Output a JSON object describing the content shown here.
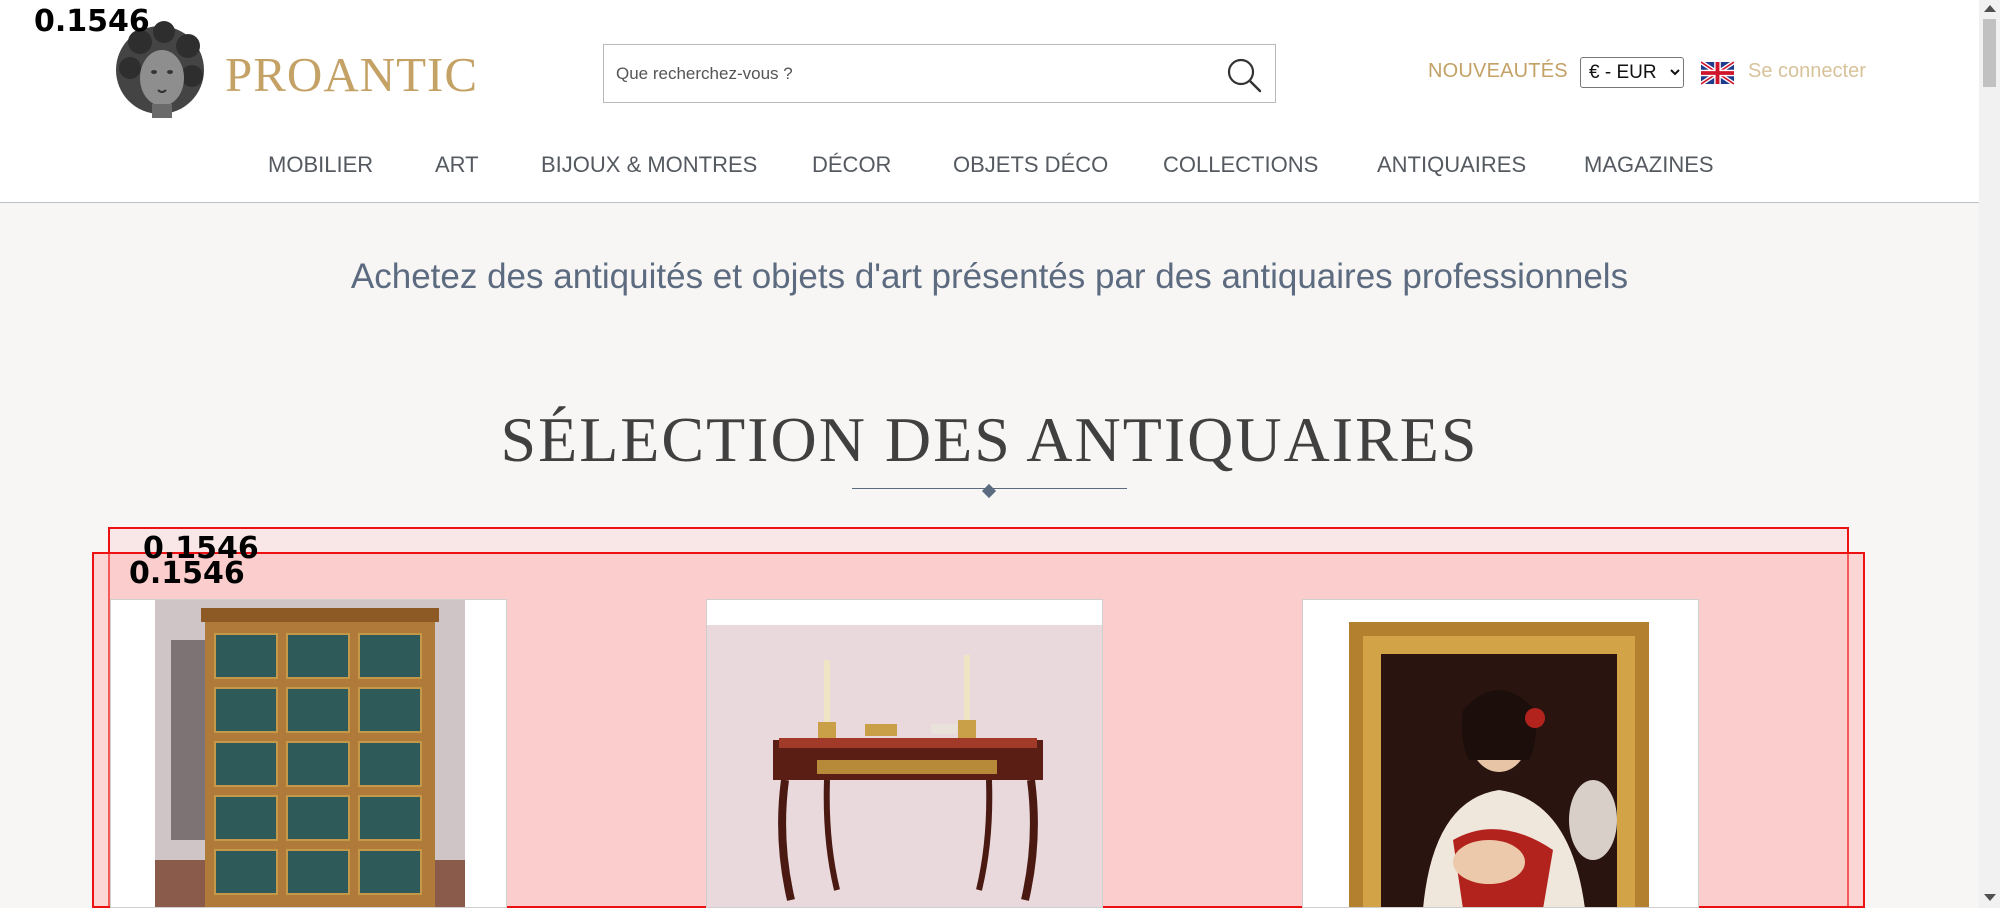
{
  "header": {
    "logo_text": "PROANTIC",
    "search": {
      "placeholder": "Que recherchez-vous ?",
      "value": ""
    },
    "new_link": "NOUVEAUTÉS",
    "currency": {
      "options": [
        "€ - EUR"
      ],
      "selected": "€ - EUR"
    },
    "language_icon": "uk-flag-icon",
    "login": "Se connecter"
  },
  "nav": {
    "items": [
      "MOBILIER",
      "ART",
      "BIJOUX & MONTRES",
      "DÉCOR",
      "OBJETS DÉCO",
      "COLLECTIONS",
      "ANTIQUAIRES",
      "MAGAZINES"
    ]
  },
  "main": {
    "tagline": "Achetez des antiquités et objets d'art présentés par des antiquaires professionnels",
    "section_title": "SÉLECTION DES ANTIQUAIRES"
  },
  "overlay_scores": [
    "0.1546",
    "0.1546",
    "0.1546"
  ],
  "colors": {
    "gold": "#c4a165",
    "slate": "#5c6b80",
    "overlay_red": "#e11111"
  }
}
